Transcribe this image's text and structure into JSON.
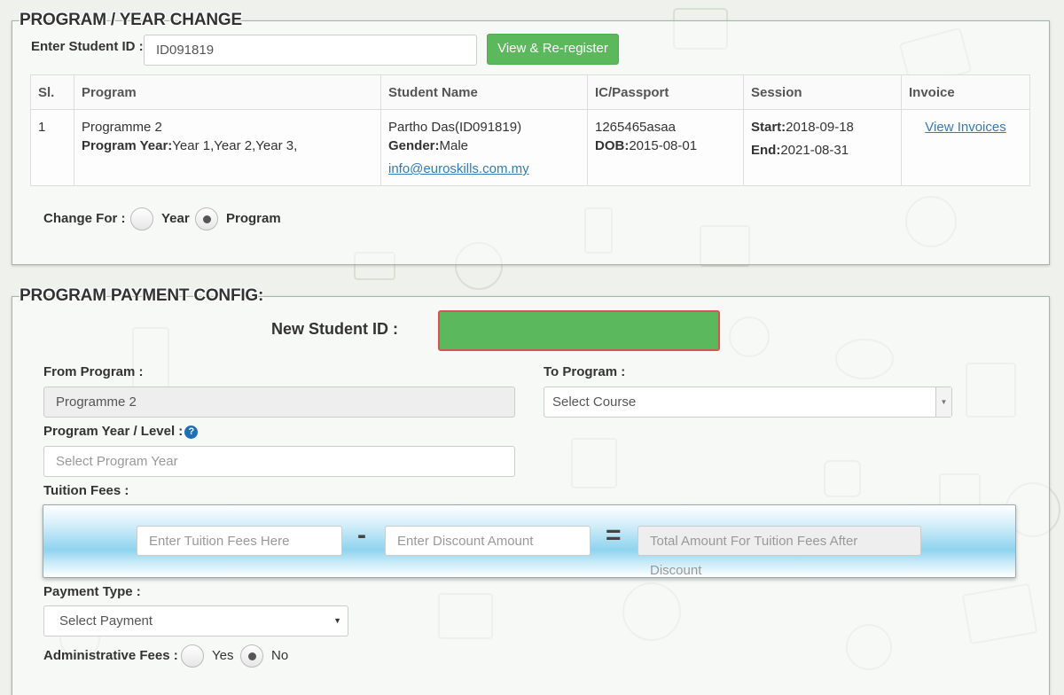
{
  "section1": {
    "title": "PROGRAM / YEAR CHANGE",
    "student_id_label": "Enter Student ID :",
    "student_id_value": "ID091819",
    "view_button": "View & Re-register",
    "table": {
      "headers": [
        "Sl.",
        "Program",
        "Student Name",
        "IC/Passport",
        "Session",
        "Invoice"
      ],
      "row": {
        "sl": "1",
        "program": "Programme 2",
        "program_year_label": "Program Year:",
        "program_year_value": "Year 1,Year 2,Year 3,",
        "student_name": "Partho Das(ID091819)",
        "gender_label": "Gender:",
        "gender_value": "Male",
        "email": "info@euroskills.com.my",
        "ic": "1265465asaa",
        "dob_label": "DOB:",
        "dob_value": "2015-08-01",
        "start_label": "Start:",
        "start_value": "2018-09-18",
        "end_label": "End:",
        "end_value": "2021-08-31",
        "invoice_link": "View Invoices"
      }
    },
    "change_for": {
      "label": "Change For :",
      "options": [
        "Year",
        "Program"
      ],
      "selected": "Program"
    }
  },
  "section2": {
    "title": "PROGRAM PAYMENT CONFIG:",
    "new_student_id_label": "New Student ID :",
    "new_student_id_value": "",
    "from_program_label": "From Program :",
    "from_program_value": "Programme 2",
    "to_program_label": "To Program :",
    "to_program_value": "Select Course",
    "program_year_label": "Program Year / Level :",
    "program_year_placeholder": "Select Program Year",
    "tuition_label": "Tuition Fees :",
    "tuition_placeholder": "Enter Tuition Fees Here",
    "minus_symbol": "-",
    "discount_placeholder": "Enter Discount Amount",
    "equals_symbol": "=",
    "total_placeholder": "Total Amount For Tuition Fees After Discount",
    "payment_type_label": "Payment Type :",
    "payment_type_value": "Select Payment",
    "admin_fees": {
      "label": "Administrative Fees :",
      "options": [
        "Yes",
        "No"
      ],
      "selected": "No"
    }
  },
  "colors": {
    "green": "#5cb85c",
    "new_id_border": "#d9534f",
    "link": "#337ab7"
  }
}
